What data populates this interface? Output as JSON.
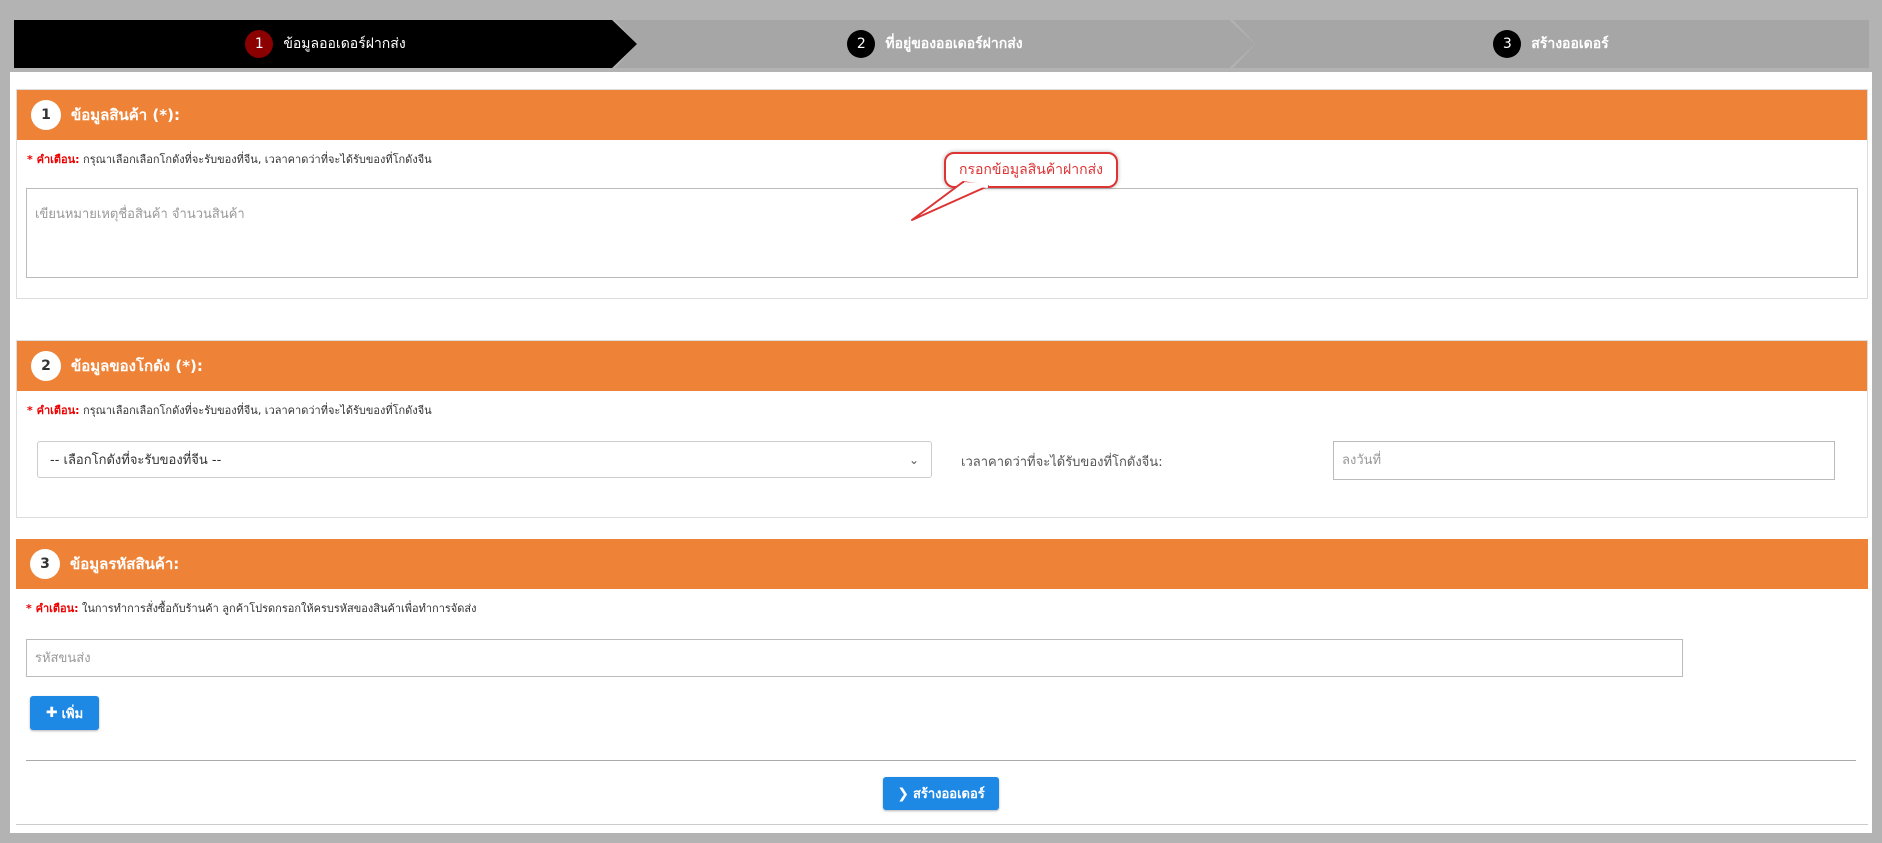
{
  "stepper": {
    "steps": [
      {
        "num": "1",
        "label": "ข้อมูลออเดอร์ฝากส่ง"
      },
      {
        "num": "2",
        "label": "ที่อยู่ของออเดอร์ฝากส่ง"
      },
      {
        "num": "3",
        "label": "สร้างออเดอร์"
      }
    ]
  },
  "section1": {
    "num": "1",
    "title": "ข้อมูลสินค้า (*):",
    "warning_prefix": "* คำเตือน:",
    "warning_text": " กรุณาเลือกเลือกโกดังที่จะรับของที่จีน, เวลาคาดว่าที่จะได้รับของที่โกดังจีน",
    "note_placeholder": "เขียนหมายเหตุชื่อสินค้า จำนวนสินค้า"
  },
  "callout": {
    "text": "กรอกข้อมูลสินค้าฝากส่ง"
  },
  "section2": {
    "num": "2",
    "title": "ข้อมูลของโกดัง (*):",
    "warning_prefix": "* คำเตือน:",
    "warning_text": " กรุณาเลือกเลือกโกดังที่จะรับของที่จีน, เวลาคาดว่าที่จะได้รับของที่โกดังจีน",
    "warehouse_select": "-- เลือกโกดังที่จะรับของที่จีน --",
    "eta_label": "เวลาคาดว่าที่จะได้รับของที่โกดังจีน:",
    "date_placeholder": "ลงวันที่"
  },
  "section3": {
    "num": "3",
    "title": "ข้อมูลรหัสสินค้า:",
    "warning_prefix": "* คำเตือน:",
    "warning_text": " ในการทำการสั่งซื้อกับร้านค้า ลูกค้าโปรดกรอกให้ครบรหัสของสินค้าเพื่อทำการจัดส่ง",
    "code_placeholder": "รหัสขนส่ง",
    "add_label": "เพิ่ม"
  },
  "footer": {
    "create_label": "สร้างออเดอร์"
  },
  "colors": {
    "accent_orange": "#ee8337",
    "button_blue": "#1e88e5",
    "warning_red": "#ee0000"
  }
}
